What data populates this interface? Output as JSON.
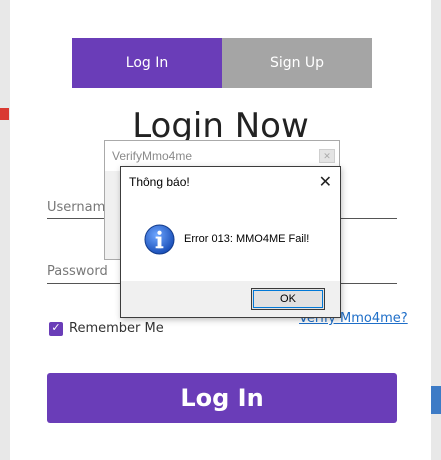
{
  "tabs": {
    "login": "Log In",
    "signup": "Sign Up"
  },
  "title": "Login Now",
  "fields": {
    "username_placeholder": "Username",
    "password_placeholder": "Password"
  },
  "remember": {
    "label": "Remember Me",
    "checked": true
  },
  "verify_link": "Verify Mmo4me?",
  "login_button": "Log In",
  "verify_window": {
    "title": "VerifyMmo4me"
  },
  "dialog": {
    "title": "Thông báo!",
    "message": "Error 013: MMO4ME Fail!",
    "ok_label": "OK",
    "close_glyph": "✕",
    "icon": "info-icon"
  },
  "colors": {
    "accent": "#6a3db8",
    "tab_inactive": "#a5a5a5",
    "link": "#1e6ec8"
  }
}
